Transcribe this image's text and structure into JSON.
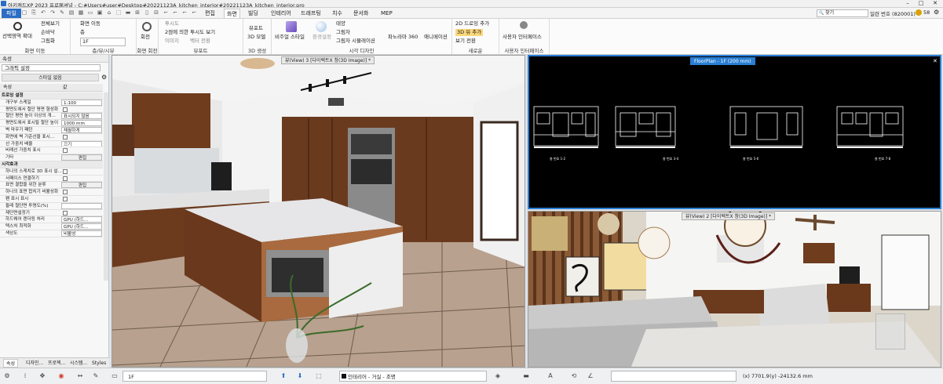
{
  "title": "아키캐드XP 2023 프로페셔널 - C:#Users#user#Desktop#20221123A_kitchen_interior#20221123A_kitchen_interior.pro",
  "window_controls": [
    "–",
    "□",
    "✕"
  ],
  "menu": [
    {
      "label": "파일",
      "kind": "file"
    },
    {
      "label": "편집",
      "kind": ""
    },
    {
      "label": "화면",
      "kind": "active"
    },
    {
      "label": "빌딩",
      "kind": ""
    },
    {
      "label": "인테리어",
      "kind": ""
    },
    {
      "label": "드래프팅",
      "kind": ""
    },
    {
      "label": "치수",
      "kind": ""
    },
    {
      "label": "문서화",
      "kind": ""
    },
    {
      "label": "MEP",
      "kind": ""
    }
  ],
  "quick_access": [
    "▢",
    "⎘",
    "↶",
    "↷",
    "✎",
    "▤",
    "▦",
    "▭",
    "▣",
    "⌂",
    "⬚",
    "▬",
    "⊞",
    "▯",
    "⊟",
    "⌐",
    "⌐",
    "⌐",
    "⌐"
  ],
  "search": {
    "icon": "🔍",
    "value": "찾기"
  },
  "user": {
    "label": "일련 번호 (820001)",
    "count": "58"
  },
  "ribbon": {
    "groups": [
      {
        "label": "화면 이동",
        "items": [
          "선택영역 확대",
          "전체보기",
          "손바닥",
          "그림화"
        ]
      },
      {
        "label": "층/뷰/시뷰",
        "items": [
          "화면 이동",
          "층",
          "1F"
        ]
      },
      {
        "label": "화면 회전",
        "items": [
          "회전"
        ]
      },
      {
        "label": "뷰포트",
        "items": [
          "투시도",
          "2점에 의한 투시도 보기",
          "이미지",
          "벡터 전환"
        ]
      },
      {
        "label": "3D 생성",
        "items": [
          "뷰포트",
          "3D 모델"
        ]
      },
      {
        "label": "시각 디자인",
        "items": [
          "비주얼 스타일",
          "환경설정",
          "태양",
          "그림자",
          "그림자 시뮬레이션",
          "파노라마 360",
          "애니메이션"
        ]
      },
      {
        "label": "새로운",
        "items": [
          "2D 드로잉 추가",
          "3D 뷰 추가",
          "보기 전환"
        ]
      },
      {
        "label": "사용자 인터페이스",
        "items": [
          "사용자 인터페이스",
          "사용자 인터페이스"
        ]
      }
    ]
  },
  "left_panel": {
    "title": "속성",
    "filter": "그래픽 설정",
    "style_btn": "스타일 없음",
    "col_key": "속성",
    "col_val": "값",
    "rows": [
      {
        "k": "트로잉 설정",
        "v": "",
        "t": "sec"
      },
      {
        "k": "개구부 스케일",
        "v": "1:100",
        "t": "dd"
      },
      {
        "k": "평면도에서 절단 평면 형성화",
        "v": "",
        "t": "chk"
      },
      {
        "k": "절단 평면 높이 이상의 개...",
        "v": "표시되지 않음",
        "t": "dd"
      },
      {
        "k": "평면도에서 표시될 절단 높이",
        "v": "1000 mm",
        "t": "dd"
      },
      {
        "k": "벽 마우기 패턴",
        "v": "채월하게",
        "t": "dd"
      },
      {
        "k": "화면에 벽 기준선을 표시...",
        "v": "",
        "t": "chk"
      },
      {
        "k": "선 가중치 배율",
        "v": "끄기",
        "t": "dd"
      },
      {
        "k": "비례선 가중치 표시",
        "v": "",
        "t": "chk"
      },
      {
        "k": "기타",
        "v": "편집",
        "t": "btn"
      },
      {
        "k": "시각효과",
        "v": "",
        "t": "sec"
      },
      {
        "k": "하나의 스케치로 3D 표시 설...",
        "v": "",
        "t": "chk"
      },
      {
        "k": "서페이스 연결하기",
        "v": "",
        "t": "chk"
      },
      {
        "k": "표면 결합을 위한 분류",
        "v": "편집",
        "t": "btn"
      },
      {
        "k": "하나의 표면 합치기 비활성화",
        "v": "",
        "t": "chk"
      },
      {
        "k": "펜 표시 표시",
        "v": "",
        "t": "chk"
      },
      {
        "k": "둘레 절단면 투명도(%)",
        "v": "",
        "t": "dd"
      },
      {
        "k": "제단면설정기",
        "v": "",
        "t": "chk"
      },
      {
        "k": "하드웨어 렌더링 처리",
        "v": "GPU (하드...",
        "t": "dd"
      },
      {
        "k": "텍스처 최적화",
        "v": "GPU (하드...",
        "t": "dd"
      },
      {
        "k": "색상도",
        "v": "비활성",
        "t": "dd"
      }
    ],
    "tabs": [
      "속성",
      "디자인...",
      "프로젝...",
      "시스템...",
      "Styles"
    ]
  },
  "views": {
    "view3": {
      "title": "뷰(View) 3 [다이렉트X 창(3D Image)] *"
    },
    "floorplan": {
      "title": "FloorPlan - 1F (200 mm)"
    },
    "view2": {
      "title": "뷰(View) 2 [다이렉트X 창(3D Image)] *"
    }
  },
  "floor_labels": [
    "층 번호 1-2",
    "층 번호 3-4",
    "층 번호 5-6",
    "층 번호 7-8"
  ],
  "status": {
    "floor": "1F",
    "layer": "인테리어 - 거실 - 조명",
    "coord_x": "(x) 7701.9",
    "coord_y": "(y) -24132.6 mm"
  },
  "colors": {
    "accent": "#2b6cc4",
    "floorplan_bg": "#000000",
    "view_border": "#2a7fd4"
  }
}
